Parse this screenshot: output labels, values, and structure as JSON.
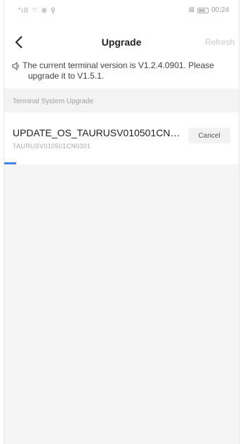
{
  "statusbar": {
    "left": "\"ıll ⌔ ⊗ ⚲",
    "right_icons": "⊠",
    "time": "00:24"
  },
  "navbar": {
    "title": "Upgrade",
    "refresh": "Refresh"
  },
  "notice": {
    "line1": "The current terminal version is V1.2.4.0901. Please",
    "line2": "upgrade it to V1.5.1."
  },
  "section": {
    "title": "Terminal System Upgrade"
  },
  "upgrade_item": {
    "title": "UPDATE_OS_TAURUSV010501CN03...",
    "subtitle": "TAURUSV010501CN0301",
    "cancel_label": "Cancel",
    "progress_percent": 5
  },
  "colors": {
    "accent": "#3f85e8",
    "section_bg": "#f3f3f3",
    "content_bg": "#f5f5f5"
  }
}
